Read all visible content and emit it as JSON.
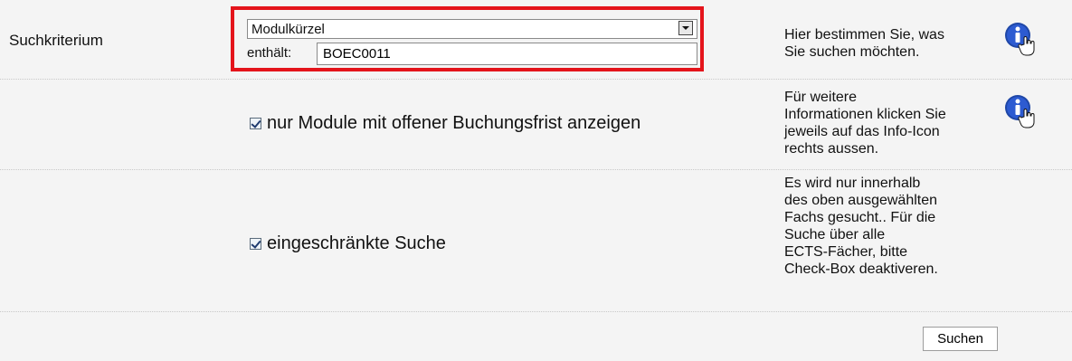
{
  "criterion": {
    "label": "Suchkriterium",
    "selected": "Modulkürzel",
    "contains_label": "enthält:",
    "contains_value": "BOEC0011"
  },
  "options": {
    "open_booking_label": "nur Module mit offener Buchungsfrist anzeigen",
    "open_booking_checked": true,
    "restricted_label": "eingeschränkte Suche",
    "restricted_checked": true
  },
  "help": {
    "criterion_lines": [
      "Hier bestimmen Sie, was",
      "Sie suchen möchten."
    ],
    "info_lines": [
      "Für weitere",
      "Informationen klicken Sie",
      "jeweils auf das Info-Icon",
      "rechts aussen."
    ],
    "restricted_lines": [
      "Es wird nur innerhalb",
      "des oben ausgewählten",
      "Fachs gesucht.. Für die",
      "Suche über alle",
      "ECTS-Fächer, bitte",
      "Check-Box deaktiveren."
    ]
  },
  "actions": {
    "search_label": "Suchen"
  },
  "icons": {
    "info": "info-icon",
    "hand_cursor": "hand-cursor-icon"
  },
  "colors": {
    "highlight": "#e4141b",
    "info_icon": "#1f47a7",
    "background": "#f4f4f4"
  }
}
